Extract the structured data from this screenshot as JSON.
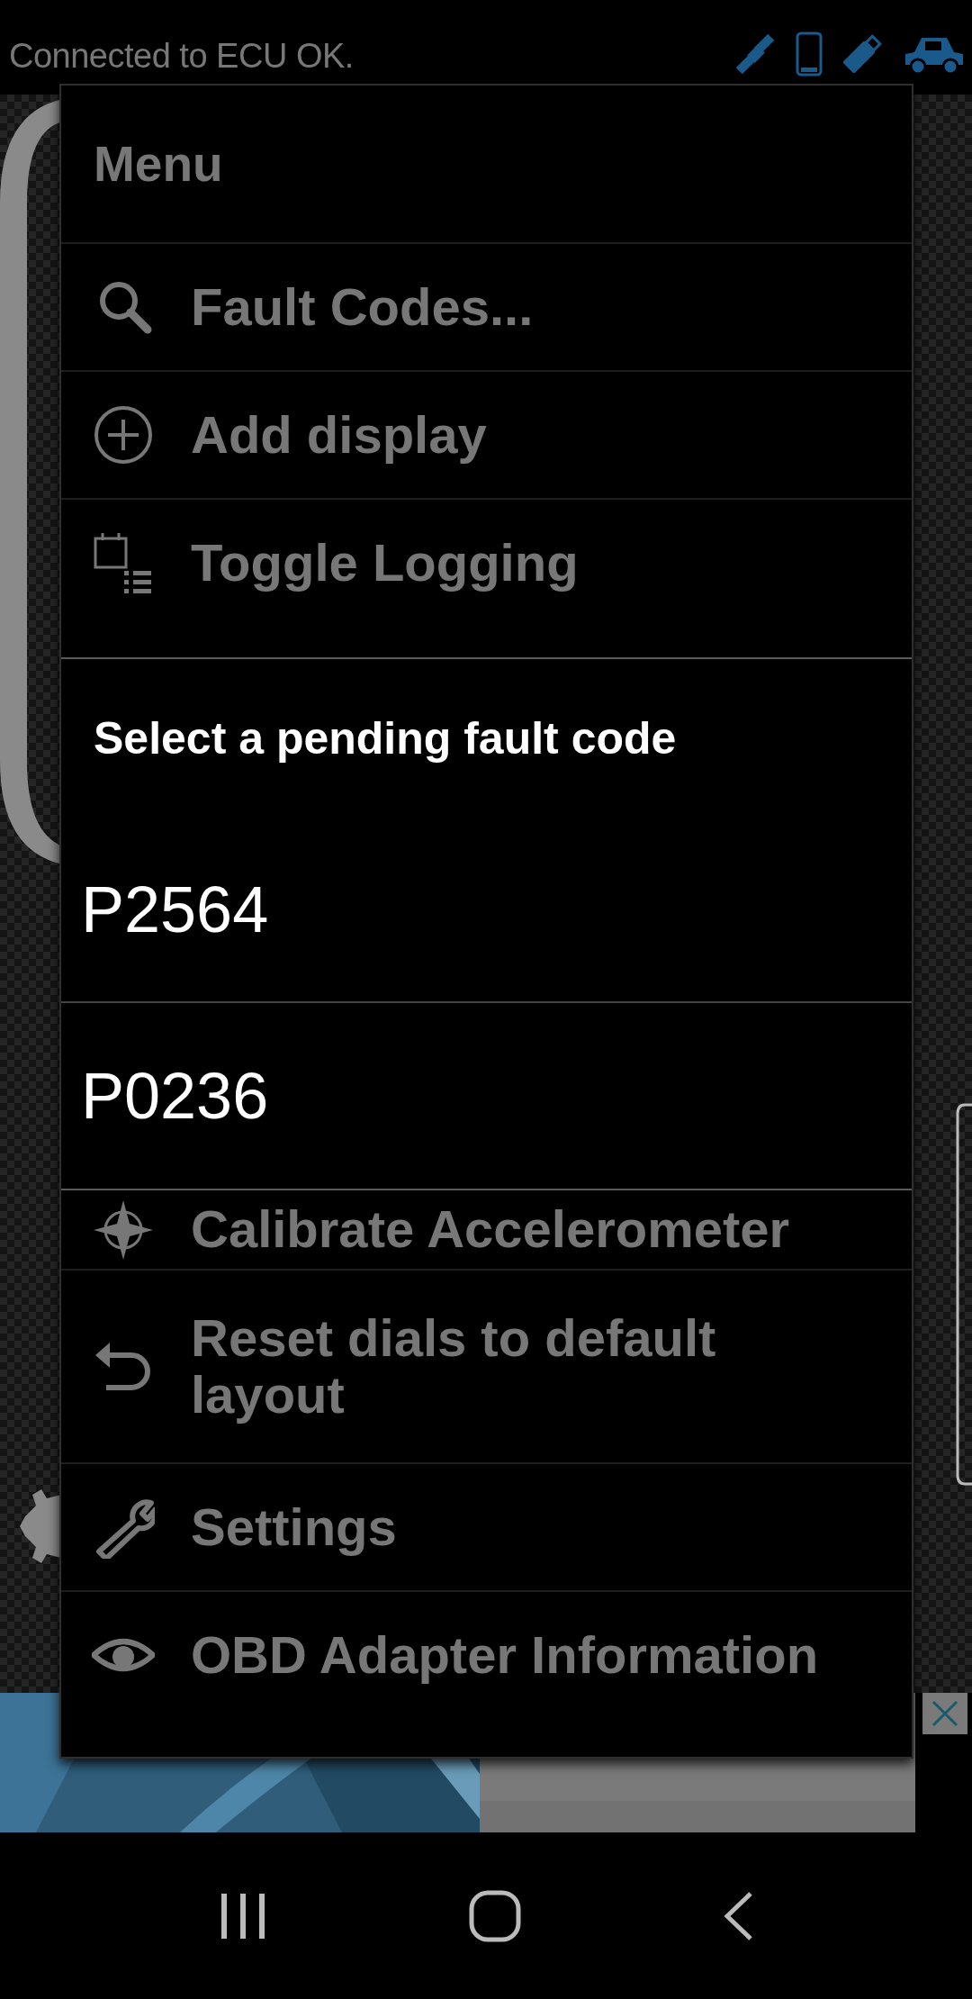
{
  "status_header": {
    "message": "Connected to ECU OK."
  },
  "menu": {
    "title": "Menu",
    "items_above_dialog": [
      {
        "label": "Fault Codes...",
        "kind": "search"
      },
      {
        "label": "Add display",
        "kind": "add"
      },
      {
        "label": "Toggle Logging",
        "kind": "log"
      }
    ],
    "items_below_dialog": [
      {
        "label": "Calibrate Accelerometer",
        "kind": "compass"
      },
      {
        "label": "Reset dials to default layout",
        "kind": "undo"
      },
      {
        "label": "Settings",
        "kind": "wrench"
      },
      {
        "label": "OBD Adapter Information",
        "kind": "eye"
      }
    ]
  },
  "dialog": {
    "title": "Select a pending fault code",
    "codes": [
      {
        "code": "P2564"
      },
      {
        "code": "P0236"
      }
    ]
  }
}
